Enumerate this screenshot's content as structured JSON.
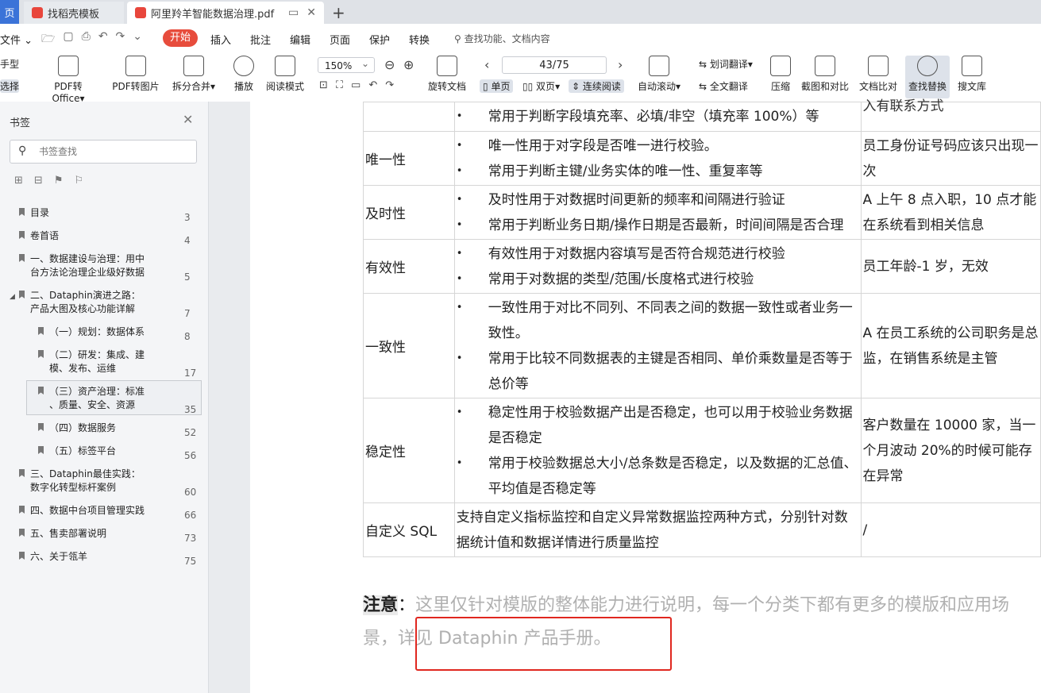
{
  "tabs": {
    "edge_label": "页",
    "tab1_label": "找稻壳模板",
    "tab2_label": "阿里羚羊智能数据治理.pdf",
    "new_tab": "+"
  },
  "menu": {
    "file": "文件",
    "start": "开始",
    "items": [
      "插入",
      "批注",
      "编辑",
      "页面",
      "保护",
      "转换"
    ],
    "search": "查找功能、文档内容"
  },
  "ribbon": {
    "hand": "手型",
    "select": "选择",
    "pdf_to_office": "PDF转Office",
    "pdf_to_image": "PDF转图片",
    "split_merge": "拆分合并",
    "play": "播放",
    "read_mode": "阅读模式",
    "zoom": "150%",
    "page_indicator": "43/75",
    "rotate": "旋转文档",
    "single_page": "单页",
    "double_page": "双页",
    "continuous": "连续阅读",
    "auto_scroll": "自动滚动",
    "word_translate": "划词翻译",
    "full_translate": "全文翻译",
    "compress": "压缩",
    "screenshot_compare": "截图和对比",
    "doc_compare": "文档比对",
    "find_replace": "查找替换",
    "search_lib": "搜文库"
  },
  "sidebar": {
    "title": "书签",
    "search_placeholder": "书签查找",
    "items": [
      {
        "label": "目录",
        "page": "3"
      },
      {
        "label": "卷首语",
        "page": "4"
      },
      {
        "label": "一、数据建设与治理：用中",
        "label2": "台方法论治理企业级好数据",
        "page": "5"
      },
      {
        "label": "二、Dataphin演进之路：",
        "label2": "产品大图及核心功能详解",
        "page": "7"
      },
      {
        "label": "（一）规划：数据体系",
        "page": "8"
      },
      {
        "label": "（二）研发：集成、建",
        "label2": "模、发布、运维",
        "page": "17"
      },
      {
        "label": "（三）资产治理：标准",
        "label2": "、质量、安全、资源",
        "page": "35"
      },
      {
        "label": "（四）数据服务",
        "page": "52"
      },
      {
        "label": "（五）标签平台",
        "page": "56"
      },
      {
        "label": "三、Dataphin最佳实践：",
        "label2": "数字化转型标杆案例",
        "page": "60"
      },
      {
        "label": "四、数据中台项目管理实践",
        "page": "66"
      },
      {
        "label": "五、售卖部署说明",
        "page": "73"
      },
      {
        "label": "六、关于瓴羊",
        "page": "75"
      }
    ]
  },
  "table": {
    "top_bullet": "常用于判断字段填充率、必填/非空（填充率 100%）等",
    "top_example": "入有联系方式",
    "rows": [
      {
        "name": "唯一性",
        "b1": "唯一性用于对字段是否唯一进行校验。",
        "b2": "常用于判断主键/业务实体的唯一性、重复率等",
        "example": "员工身份证号码应该只出现一次"
      },
      {
        "name": "及时性",
        "b1": "及时性用于对数据时间更新的频率和间隔进行验证",
        "b2": "常用于判断业务日期/操作日期是否最新，时间间隔是否合理",
        "example": "A 上午 8 点入职，10 点才能在系统看到相关信息"
      },
      {
        "name": "有效性",
        "b1": "有效性用于对数据内容填写是否符合规范进行校验",
        "b2": "常用于对数据的类型/范围/长度格式进行校验",
        "example": "员工年龄-1 岁，无效"
      },
      {
        "name": "一致性",
        "b1": "一致性用于对比不同列、不同表之间的数据一致性或者业务一致性。",
        "b2": "常用于比较不同数据表的主键是否相同、单价乘数量是否等于总价等",
        "example": "A 在员工系统的公司职务是总监，在销售系统是主管"
      },
      {
        "name": "稳定性",
        "b1": "稳定性用于校验数据产出是否稳定，也可以用于校验业务数据是否稳定",
        "b2": "常用于校验数据总大小/总条数是否稳定，以及数据的汇总值、平均值是否稳定等",
        "example": "客户数量在 10000 家，当一个月波动 20%的时候可能存在异常"
      },
      {
        "name": "自定义 SQL",
        "desc": "支持自定义指标监控和自定义异常数据监控两种方式，分别针对数据统计值和数据详情进行质量监控",
        "example": "/"
      }
    ]
  },
  "note": {
    "label": "注意",
    "colon": "：",
    "text_a": "这里仅针对模版的整体能力进行说明，每一个分类下都有更多的模版和应用场景，",
    "text_b": "详见 Dataphin 产品手册。"
  },
  "colors": {
    "accent_red": "#e74c3c",
    "highlight_box": "#e0271f"
  }
}
